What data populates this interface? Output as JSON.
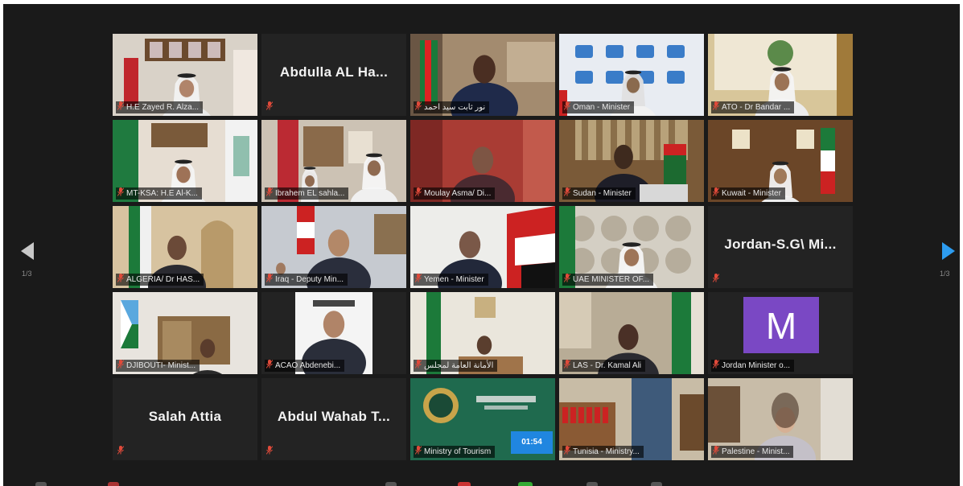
{
  "tiles": [
    {
      "label": "H.E Zayed R. Alza...",
      "scene": "flags-office",
      "big": ""
    },
    {
      "label": "",
      "scene": "blank",
      "big": "Abdulla AL Ha..."
    },
    {
      "label": "نور ثابت سيد احمد",
      "scene": "office-flag-green",
      "big": ""
    },
    {
      "label": "Oman - Minister",
      "scene": "logo-wall",
      "big": ""
    },
    {
      "label": "ATO - Dr Bandar ...",
      "scene": "emblem-room",
      "big": ""
    },
    {
      "label": "MT-KSA: H.E Al-K...",
      "scene": "green-flag-room",
      "big": ""
    },
    {
      "label": "Ibrahem EL sahla...",
      "scene": "office-white",
      "big": ""
    },
    {
      "label": "Moulay Asma/ Di...",
      "scene": "red-room",
      "big": ""
    },
    {
      "label": "Sudan - Minister",
      "scene": "wood-office",
      "big": ""
    },
    {
      "label": "Kuwait - Minister",
      "scene": "wood-flag",
      "big": "",
      "highlight": true
    },
    {
      "label": "ALGERIA/ Dr HAS...",
      "scene": "arched-room",
      "big": ""
    },
    {
      "label": "Iraq - Deputy Min...",
      "scene": "office-blue",
      "big": ""
    },
    {
      "label": "Yemen - Minister",
      "scene": "white-flag",
      "big": ""
    },
    {
      "label": "UAE MINISTER OF...",
      "scene": "ornament-wall",
      "big": ""
    },
    {
      "label": "",
      "scene": "blank",
      "big": "Jordan-S.G\\  Mi..."
    },
    {
      "label": "DJIBOUTI- Minist...",
      "scene": "wood-shelf",
      "big": ""
    },
    {
      "label": "ACAO Abdenebi...",
      "scene": "portrait",
      "big": ""
    },
    {
      "label": "الأمانة العامة لمجلس",
      "scene": "green-curtain",
      "big": ""
    },
    {
      "label": "LAS - Dr. Kamal Ali",
      "scene": "office-beige",
      "big": ""
    },
    {
      "label": "Jordan Minister o...",
      "scene": "avatar",
      "big": "",
      "avatar_letter": "M"
    },
    {
      "label": "",
      "scene": "blank",
      "big": "Salah Attia"
    },
    {
      "label": "",
      "scene": "blank",
      "big": "Abdul  Wahab  T..."
    },
    {
      "label": "Ministry of Tourism",
      "scene": "tourism-logo",
      "big": "",
      "timer": "01:54"
    },
    {
      "label": "Tunisia - Ministry...",
      "scene": "library",
      "big": ""
    },
    {
      "label": "Palestine - Minist...",
      "scene": "home-room",
      "big": ""
    }
  ],
  "pager": {
    "left_page": "1/3",
    "right_page": "1/3"
  },
  "colors": {
    "mic_muted": "#e04a3a",
    "active_speaker": "#d8c23a",
    "nav_arrow_active": "#2d9cf0"
  }
}
